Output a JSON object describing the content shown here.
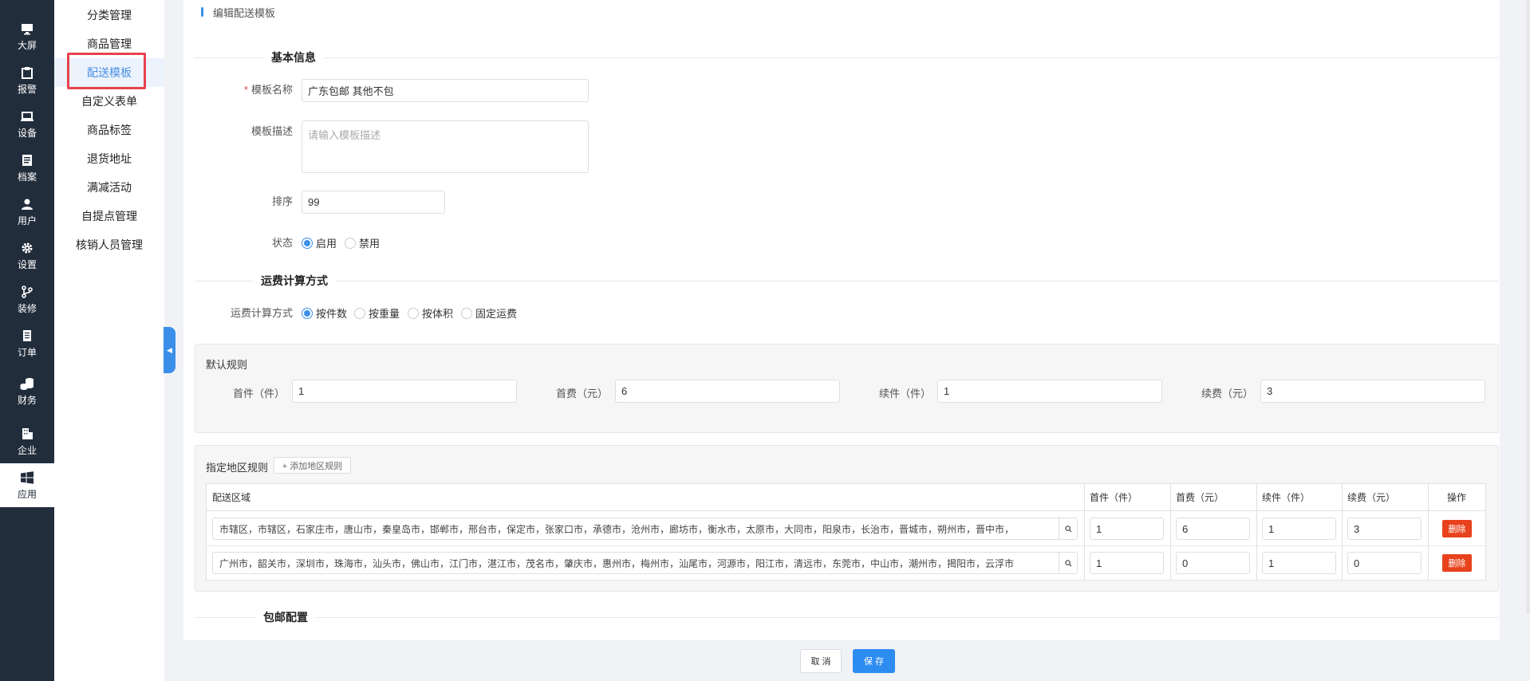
{
  "rail": [
    {
      "label": "大屏",
      "icon": "monitor-icon"
    },
    {
      "label": "报警",
      "icon": "clipboard-icon"
    },
    {
      "label": "设备",
      "icon": "laptop-icon"
    },
    {
      "label": "档案",
      "icon": "document-icon"
    },
    {
      "label": "用户",
      "icon": "user-icon"
    },
    {
      "label": "设置",
      "icon": "gear-icon"
    },
    {
      "label": "装修",
      "icon": "branch-icon"
    },
    {
      "label": "订单",
      "icon": "order-icon"
    },
    {
      "label": "财务",
      "icon": "coins-icon"
    },
    {
      "label": "企业",
      "icon": "building-icon"
    },
    {
      "label": "应用",
      "icon": "windows-icon"
    }
  ],
  "submenu": [
    "分类管理",
    "商品管理",
    "配送模板",
    "自定义表单",
    "商品标签",
    "退货地址",
    "满减活动",
    "自提点管理",
    "核销人员管理"
  ],
  "page": {
    "heading": "编辑配送模板",
    "section_basic": "基本信息",
    "section_fee": "运费计算方式",
    "section_free": "包邮配置"
  },
  "form": {
    "name_label": "模板名称",
    "required_mark": "*",
    "name_value": "广东包邮 其他不包",
    "desc_label": "模板描述",
    "desc_placeholder": "请输入模板描述",
    "sort_label": "排序",
    "sort_value": "99",
    "status_label": "状态",
    "status_options": [
      "启用",
      "禁用"
    ],
    "fee_label": "运费计算方式",
    "fee_options": [
      "按件数",
      "按重量",
      "按体积",
      "固定运费"
    ]
  },
  "default_rule": {
    "title": "默认规则",
    "first_label": "首件（件）",
    "first_value": "1",
    "first_fee_label": "首费（元）",
    "first_fee_value": "6",
    "next_label": "续件（件）",
    "next_value": "1",
    "next_fee_label": "续费（元）",
    "next_fee_value": "3"
  },
  "region_rule": {
    "title": "指定地区规则",
    "add_button": "+ 添加地区规则",
    "headers": [
      "配送区域",
      "首件（件）",
      "首费（元）",
      "续件（件）",
      "续费（元）",
      "操作"
    ],
    "rows": [
      {
        "region": "市辖区，市辖区，石家庄市，唐山市，秦皇岛市，邯郸市，邢台市，保定市，张家口市，承德市，沧州市，廊坊市，衡水市，太原市，大同市，阳泉市，长治市，晋城市，朔州市，晋中市，",
        "first": "1",
        "first_fee": "6",
        "next": "1",
        "next_fee": "3",
        "action": "删除"
      },
      {
        "region": "广州市，韶关市，深圳市，珠海市，汕头市，佛山市，江门市，湛江市，茂名市，肇庆市，惠州市，梅州市，汕尾市，河源市，阳江市，清远市，东莞市，中山市，潮州市，揭阳市，云浮市",
        "first": "1",
        "first_fee": "0",
        "next": "1",
        "next_fee": "0",
        "action": "删除"
      }
    ]
  },
  "footer": {
    "cancel": "取 消",
    "save": "保 存"
  },
  "colors": {
    "primary": "#3b8fea",
    "danger": "#e8421c",
    "rail_bg": "#222d3c",
    "highlight": "#e8424f"
  }
}
